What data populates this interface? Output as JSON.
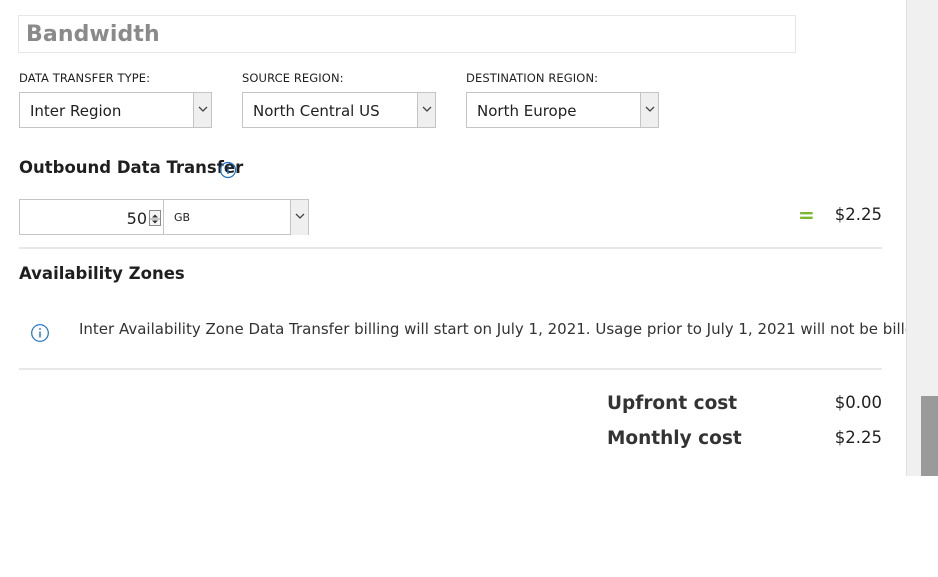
{
  "section": {
    "title": "Bandwidth"
  },
  "fields": {
    "transfer_type": {
      "label": "DATA TRANSFER TYPE:",
      "value": "Inter Region"
    },
    "source_region": {
      "label": "SOURCE REGION:",
      "value": "North Central US"
    },
    "destination_region": {
      "label": "DESTINATION REGION:",
      "value": "North Europe"
    }
  },
  "outbound": {
    "heading": "Outbound Data Transfer",
    "quantity": "50",
    "unit": "GB",
    "equals": "=",
    "price": "$2.25"
  },
  "availability": {
    "heading": "Availability Zones",
    "notice": "Inter Availability Zone Data Transfer billing will start on July 1, 2021. Usage prior to July 1, 2021 will not be billed."
  },
  "summary": {
    "upfront_label": "Upfront cost",
    "upfront_value": "$0.00",
    "monthly_label": "Monthly cost",
    "monthly_value": "$2.25"
  },
  "colors": {
    "accent_green": "#7cb82f",
    "info_blue": "#1a73c8"
  }
}
